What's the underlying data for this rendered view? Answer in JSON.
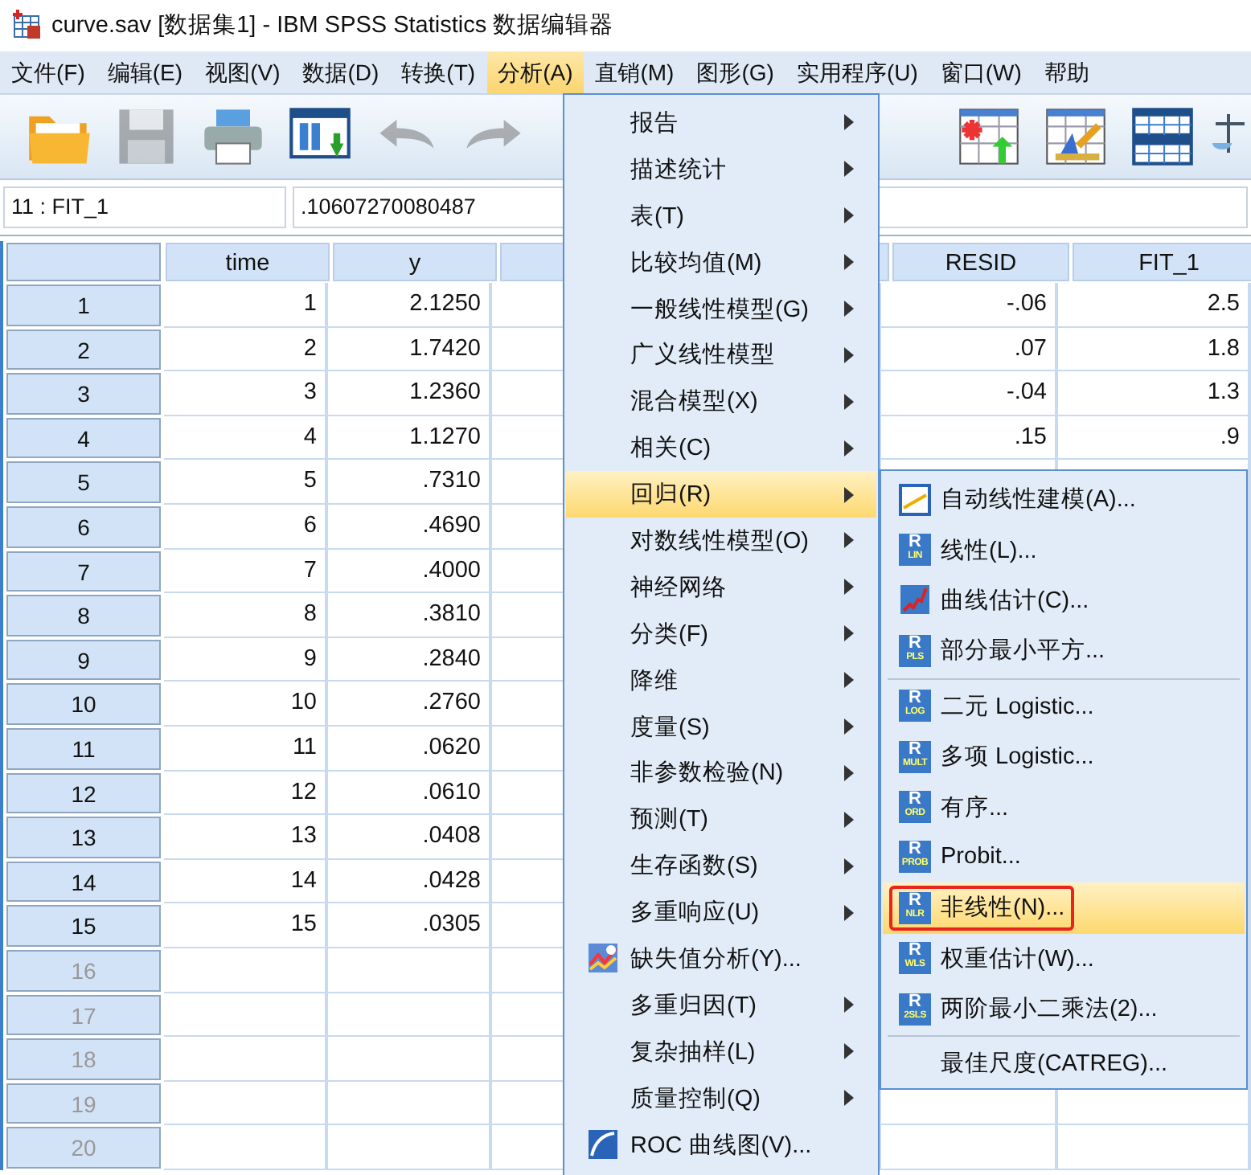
{
  "window": {
    "title": "curve.sav [数据集1] - IBM SPSS Statistics 数据编辑器"
  },
  "menubar": [
    {
      "label": "文件(F)",
      "selected": false
    },
    {
      "label": "编辑(E)",
      "selected": false
    },
    {
      "label": "视图(V)",
      "selected": false
    },
    {
      "label": "数据(D)",
      "selected": false
    },
    {
      "label": "转换(T)",
      "selected": false
    },
    {
      "label": "分析(A)",
      "selected": true
    },
    {
      "label": "直销(M)",
      "selected": false
    },
    {
      "label": "图形(G)",
      "selected": false
    },
    {
      "label": "实用程序(U)",
      "selected": false
    },
    {
      "label": "窗口(W)",
      "selected": false
    },
    {
      "label": "帮助",
      "selected": false
    }
  ],
  "toolbar": [
    {
      "kind": "open",
      "disabled": false
    },
    {
      "kind": "save",
      "disabled": true
    },
    {
      "kind": "print",
      "disabled": false
    },
    {
      "kind": "recall",
      "disabled": false
    },
    {
      "kind": "undo",
      "disabled": true
    },
    {
      "kind": "redo",
      "disabled": true
    },
    {
      "kind": "insert-case",
      "disabled": false
    },
    {
      "kind": "variable",
      "disabled": false
    },
    {
      "kind": "split",
      "disabled": false
    },
    {
      "kind": "weight",
      "disabled": false
    }
  ],
  "cell_bar": {
    "reference": "11 : FIT_1",
    "value": ".10607270080487"
  },
  "table": {
    "columns": [
      "time",
      "y",
      "",
      "RESID",
      "FIT_1"
    ],
    "rows": [
      {
        "num": "1",
        "greyed": false,
        "cells": [
          "1",
          "2.1250",
          "",
          "-.06",
          "2.5"
        ]
      },
      {
        "num": "2",
        "greyed": false,
        "cells": [
          "2",
          "1.7420",
          "",
          ".07",
          "1.8"
        ]
      },
      {
        "num": "3",
        "greyed": false,
        "cells": [
          "3",
          "1.2360",
          "",
          "-.04",
          "1.3"
        ]
      },
      {
        "num": "4",
        "greyed": false,
        "cells": [
          "4",
          "1.1270",
          "",
          ".15",
          ".9"
        ]
      },
      {
        "num": "5",
        "greyed": false,
        "cells": [
          "5",
          ".7310"
        ]
      },
      {
        "num": "6",
        "greyed": false,
        "cells": [
          "6",
          ".4690"
        ]
      },
      {
        "num": "7",
        "greyed": false,
        "cells": [
          "7",
          ".4000"
        ]
      },
      {
        "num": "8",
        "greyed": false,
        "cells": [
          "8",
          ".3810"
        ]
      },
      {
        "num": "9",
        "greyed": false,
        "cells": [
          "9",
          ".2840"
        ]
      },
      {
        "num": "10",
        "greyed": false,
        "cells": [
          "10",
          ".2760"
        ]
      },
      {
        "num": "11",
        "greyed": false,
        "cells": [
          "11",
          ".0620"
        ]
      },
      {
        "num": "12",
        "greyed": false,
        "cells": [
          "12",
          ".0610"
        ]
      },
      {
        "num": "13",
        "greyed": false,
        "cells": [
          "13",
          ".0408"
        ]
      },
      {
        "num": "14",
        "greyed": false,
        "cells": [
          "14",
          ".0428"
        ]
      },
      {
        "num": "15",
        "greyed": false,
        "cells": [
          "15",
          ".0305"
        ]
      },
      {
        "num": "16",
        "greyed": true,
        "cells": []
      },
      {
        "num": "17",
        "greyed": true,
        "cells": []
      },
      {
        "num": "18",
        "greyed": true,
        "cells": []
      },
      {
        "num": "19",
        "greyed": true,
        "cells": []
      },
      {
        "num": "20",
        "greyed": true,
        "cells": []
      }
    ]
  },
  "analyze_menu": [
    {
      "label": "报告",
      "submenu": true,
      "kind": "plain",
      "selected": false
    },
    {
      "label": "描述统计",
      "submenu": true,
      "kind": "plain",
      "selected": false
    },
    {
      "label": "表(T)",
      "submenu": true,
      "kind": "plain",
      "selected": false
    },
    {
      "label": "比较均值(M)",
      "submenu": true,
      "kind": "plain",
      "selected": false
    },
    {
      "label": "一般线性模型(G)",
      "submenu": true,
      "kind": "plain",
      "selected": false
    },
    {
      "label": "广义线性模型",
      "submenu": true,
      "kind": "plain",
      "selected": false
    },
    {
      "label": "混合模型(X)",
      "submenu": true,
      "kind": "plain",
      "selected": false
    },
    {
      "label": "相关(C)",
      "submenu": true,
      "kind": "plain",
      "selected": false
    },
    {
      "label": "回归(R)",
      "submenu": true,
      "kind": "plain",
      "selected": true
    },
    {
      "label": "对数线性模型(O)",
      "submenu": true,
      "kind": "plain",
      "selected": false
    },
    {
      "label": "神经网络",
      "submenu": true,
      "kind": "plain",
      "selected": false
    },
    {
      "label": "分类(F)",
      "submenu": true,
      "kind": "plain",
      "selected": false
    },
    {
      "label": "降维",
      "submenu": true,
      "kind": "plain",
      "selected": false
    },
    {
      "label": "度量(S)",
      "submenu": true,
      "kind": "plain",
      "selected": false
    },
    {
      "label": "非参数检验(N)",
      "submenu": true,
      "kind": "plain",
      "selected": false
    },
    {
      "label": "预测(T)",
      "submenu": true,
      "kind": "plain",
      "selected": false
    },
    {
      "label": "生存函数(S)",
      "submenu": true,
      "kind": "plain",
      "selected": false
    },
    {
      "label": "多重响应(U)",
      "submenu": true,
      "kind": "plain",
      "selected": false
    },
    {
      "label": "缺失值分析(Y)...",
      "submenu": false,
      "kind": "missing",
      "selected": false
    },
    {
      "label": "多重归因(T)",
      "submenu": true,
      "kind": "plain",
      "selected": false
    },
    {
      "label": "复杂抽样(L)",
      "submenu": true,
      "kind": "plain",
      "selected": false
    },
    {
      "label": "质量控制(Q)",
      "submenu": true,
      "kind": "plain",
      "selected": false
    },
    {
      "label": "ROC 曲线图(V)...",
      "submenu": false,
      "kind": "roc",
      "selected": false
    }
  ],
  "regression_menu": [
    {
      "label": "自动线性建模(A)...",
      "kind": "auto",
      "selected": false,
      "marked": false,
      "separator_after": false
    },
    {
      "label": "线性(L)...",
      "kind": "badge",
      "badge": [
        "R",
        "LIN"
      ],
      "selected": false,
      "marked": false,
      "separator_after": false
    },
    {
      "label": "曲线估计(C)...",
      "kind": "curve",
      "selected": false,
      "marked": false,
      "separator_after": false
    },
    {
      "label": "部分最小平方...",
      "kind": "badge",
      "badge": [
        "R",
        "PLS"
      ],
      "selected": false,
      "marked": false,
      "separator_after": true
    },
    {
      "label": "二元 Logistic...",
      "kind": "badge",
      "badge": [
        "R",
        "LOG"
      ],
      "selected": false,
      "marked": false,
      "separator_after": false
    },
    {
      "label": "多项 Logistic...",
      "kind": "badge",
      "badge": [
        "R",
        "MULT"
      ],
      "selected": false,
      "marked": false,
      "separator_after": false
    },
    {
      "label": "有序...",
      "kind": "badge",
      "badge": [
        "R",
        "ORD"
      ],
      "selected": false,
      "marked": false,
      "separator_after": false
    },
    {
      "label": "Probit...",
      "kind": "badge",
      "badge": [
        "R",
        "PROB"
      ],
      "selected": false,
      "marked": false,
      "separator_after": false
    },
    {
      "label": "非线性(N)...",
      "kind": "badge",
      "badge": [
        "R",
        "NLR"
      ],
      "selected": true,
      "marked": true,
      "separator_after": false
    },
    {
      "label": "权重估计(W)...",
      "kind": "badge",
      "badge": [
        "R",
        "WLS"
      ],
      "selected": false,
      "marked": false,
      "separator_after": false
    },
    {
      "label": "两阶最小二乘法(2)...",
      "kind": "badge",
      "badge": [
        "R",
        "2SLS"
      ],
      "selected": false,
      "marked": false,
      "separator_after": true
    },
    {
      "label": "最佳尺度(CATREG)...",
      "kind": "plain",
      "selected": false,
      "marked": false,
      "separator_after": false
    }
  ]
}
